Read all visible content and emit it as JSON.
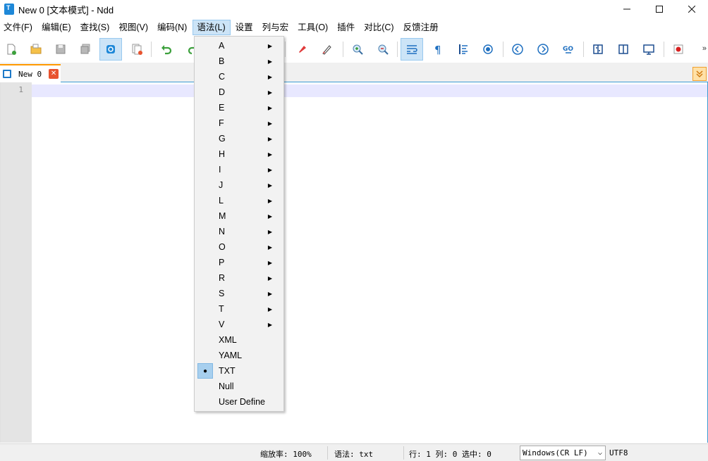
{
  "window": {
    "title": "New 0 [文本模式] - Ndd",
    "controls": [
      "minimize-icon",
      "maximize-icon",
      "close-icon"
    ]
  },
  "menubar": {
    "items": [
      {
        "label": "文件(F)"
      },
      {
        "label": "编辑(E)"
      },
      {
        "label": "查找(S)"
      },
      {
        "label": "视图(V)"
      },
      {
        "label": "编码(N)"
      },
      {
        "label": "语法(L)",
        "active": true
      },
      {
        "label": "设置"
      },
      {
        "label": "列与宏"
      },
      {
        "label": "工具(O)"
      },
      {
        "label": "插件"
      },
      {
        "label": "对比(C)"
      },
      {
        "label": "反馈注册"
      }
    ]
  },
  "toolbar": {
    "icons": [
      "new-file-icon",
      "open-file-icon",
      "save-icon",
      "save-all-icon",
      "sync-icon",
      "close-all-icon",
      "undo-icon",
      "redo-icon",
      "highlight-icon",
      "clear-highlight-icon",
      "zoom-in-icon",
      "zoom-out-icon",
      "word-wrap-icon",
      "show-symbols-icon",
      "indent-guide-icon",
      "target-icon",
      "prev-icon",
      "next-icon",
      "goto-icon",
      "compare-dir-icon",
      "compare-file-icon",
      "hex-icon",
      "record-macro-icon"
    ],
    "more": "»"
  },
  "tabs": [
    {
      "label": "New 0",
      "active": true
    }
  ],
  "editor": {
    "line_numbers": [
      "1"
    ]
  },
  "syntax_menu": {
    "items": [
      {
        "label": "A",
        "submenu": true
      },
      {
        "label": "B",
        "submenu": true
      },
      {
        "label": "C",
        "submenu": true
      },
      {
        "label": "D",
        "submenu": true
      },
      {
        "label": "E",
        "submenu": true
      },
      {
        "label": "F",
        "submenu": true
      },
      {
        "label": "G",
        "submenu": true
      },
      {
        "label": "H",
        "submenu": true
      },
      {
        "label": "I",
        "submenu": true
      },
      {
        "label": "J",
        "submenu": true
      },
      {
        "label": "L",
        "submenu": true
      },
      {
        "label": "M",
        "submenu": true
      },
      {
        "label": "N",
        "submenu": true
      },
      {
        "label": "O",
        "submenu": true
      },
      {
        "label": "P",
        "submenu": true
      },
      {
        "label": "R",
        "submenu": true
      },
      {
        "label": "S",
        "submenu": true
      },
      {
        "label": "T",
        "submenu": true
      },
      {
        "label": "V",
        "submenu": true
      },
      {
        "label": "XML",
        "submenu": false
      },
      {
        "label": "YAML",
        "submenu": false
      },
      {
        "label": "TXT",
        "submenu": false,
        "checked": true
      },
      {
        "label": "Null",
        "submenu": false
      },
      {
        "label": "User Define",
        "submenu": false
      }
    ],
    "arrow_glyph": "▶",
    "check_glyph": "●"
  },
  "statusbar": {
    "zoom": "缩放率: 100%",
    "syntax": "语法: txt",
    "position": "行: 1 列: 0 选中: 0",
    "line_ending": "Windows(CR LF)",
    "encoding": "UTF8"
  },
  "colors": {
    "accent": "#3c9bd3",
    "tab_highlight": "#ff9900",
    "pressed_button": "#cce4f7",
    "current_line": "#e8e8ff"
  }
}
